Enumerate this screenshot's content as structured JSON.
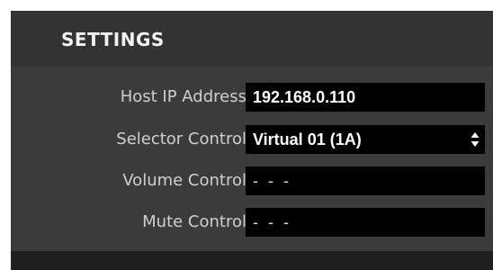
{
  "settings": {
    "title": "SETTINGS",
    "host_ip": {
      "label": "Host IP Address",
      "value": "192.168.0.110"
    },
    "selector": {
      "label": "Selector Control",
      "value": "Virtual 01 (1A)",
      "icon": "updown-arrows-icon"
    },
    "volume": {
      "label": "Volume Control",
      "value": "- - -"
    },
    "mute": {
      "label": "Mute Control",
      "value": "- - -"
    }
  },
  "colors": {
    "panel_bg": "#3b3b3b",
    "header_bg": "#333333",
    "field_bg": "#000000",
    "label_text": "#cfcfcf",
    "value_text": "#ffffff"
  }
}
